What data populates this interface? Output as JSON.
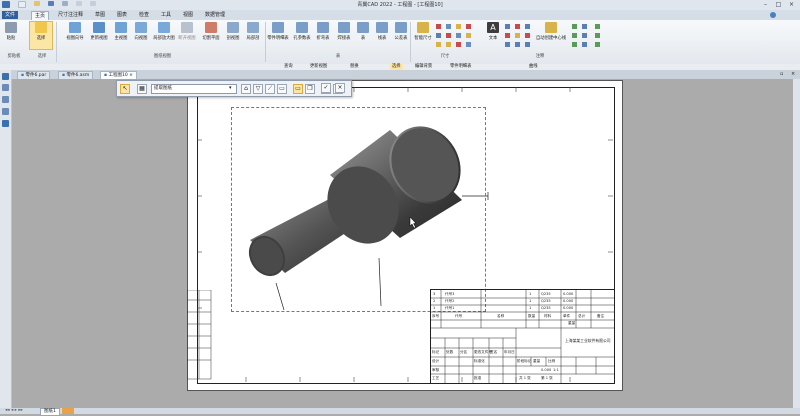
{
  "window": {
    "title": "青翼CAD 2022 - 工程图 - [工程图10]"
  },
  "menu": {
    "tabs": [
      "文件",
      "主页",
      "尺寸注注释",
      "草图",
      "图表",
      "检查",
      "工具",
      "视图",
      "数据管理"
    ]
  },
  "ribbon": {
    "buttons": [
      {
        "label": "粘贴",
        "color": "#8c9bb0"
      },
      {
        "label": "选择",
        "color": "#f0c74a"
      },
      {
        "label": "视图向导",
        "color": "#6fa2d6"
      },
      {
        "label": "更新视图",
        "color": "#5b8fc7"
      },
      {
        "label": "主视图",
        "color": "#6fa2d6"
      },
      {
        "label": "向视图",
        "color": "#7aa8d8"
      },
      {
        "label": "局部放大图",
        "color": "#7aa8d8"
      },
      {
        "label": "断开视图",
        "color": "#b8c2ce"
      },
      {
        "label": "切割平面",
        "color": "#d07a6a"
      },
      {
        "label": "剖视图",
        "color": "#8aa9cc"
      },
      {
        "label": "局部剖",
        "color": "#8aa9cc"
      },
      {
        "label": "零件明细表",
        "color": "#7b9ec9"
      },
      {
        "label": "孔参数表",
        "color": "#7b9ec9"
      },
      {
        "label": "折弯表",
        "color": "#7b9ec9"
      },
      {
        "label": "焊接表",
        "color": "#7b9ec9"
      },
      {
        "label": "表",
        "color": "#7b9ec9"
      },
      {
        "label": "线表",
        "color": "#7b9ec9"
      },
      {
        "label": "公差表",
        "color": "#7b9ec9"
      },
      {
        "label": "智能尺寸",
        "color": "#d8b34a"
      },
      {
        "label": "文本",
        "color": "#3d3d3d"
      },
      {
        "label": "自动创建中心线",
        "color": "#d8b34a"
      }
    ],
    "groups": [
      "剪贴板",
      "选择",
      "图纸视图",
      "表",
      "尺寸",
      "注释"
    ]
  },
  "subbar": {
    "items": [
      "查询",
      "更新视图",
      "替换",
      "选择",
      "编辑背景",
      "零件明细表",
      "曲线"
    ]
  },
  "doc_tabs": [
    {
      "label": "零件6.par"
    },
    {
      "label": "零件6.asm"
    },
    {
      "label": "工程图10"
    }
  ],
  "float_toolbar": {
    "filter_value": "提取图纸"
  },
  "title_block": {
    "company": "上海某某工业软件有限公司",
    "scale": "1:1",
    "weight": "0.000",
    "sheet_info": "第 1 张",
    "total_sheets": "共 1 张",
    "labels": {
      "seq": "序号",
      "code": "代号",
      "name": "名称",
      "qty": "数量",
      "material": "材料",
      "single_weight": "单件",
      "total_weight": "总计",
      "weight_label": "重量",
      "remark": "备注",
      "design": "设计",
      "check": "审核",
      "process": "工艺",
      "approve": "批准",
      "mark": "标记",
      "count": "处数",
      "zone": "分区",
      "change_doc": "更改文件号",
      "signature": "签名",
      "date": "年月日",
      "stage_mark": "阶段标记",
      "ratio": "比例",
      "standardize": "标准化"
    },
    "rows": [
      {
        "seq": "3",
        "code": "代号3",
        "qty": "1",
        "material": "Q235",
        "single": "0.000"
      },
      {
        "seq": "2",
        "code": "代号2",
        "qty": "1",
        "material": "Q235",
        "single": "0.000"
      },
      {
        "seq": "1",
        "code": "代号1",
        "qty": "1",
        "material": "Q235",
        "single": "0.000"
      }
    ]
  },
  "status": {
    "sheet_tab": "图纸1"
  }
}
